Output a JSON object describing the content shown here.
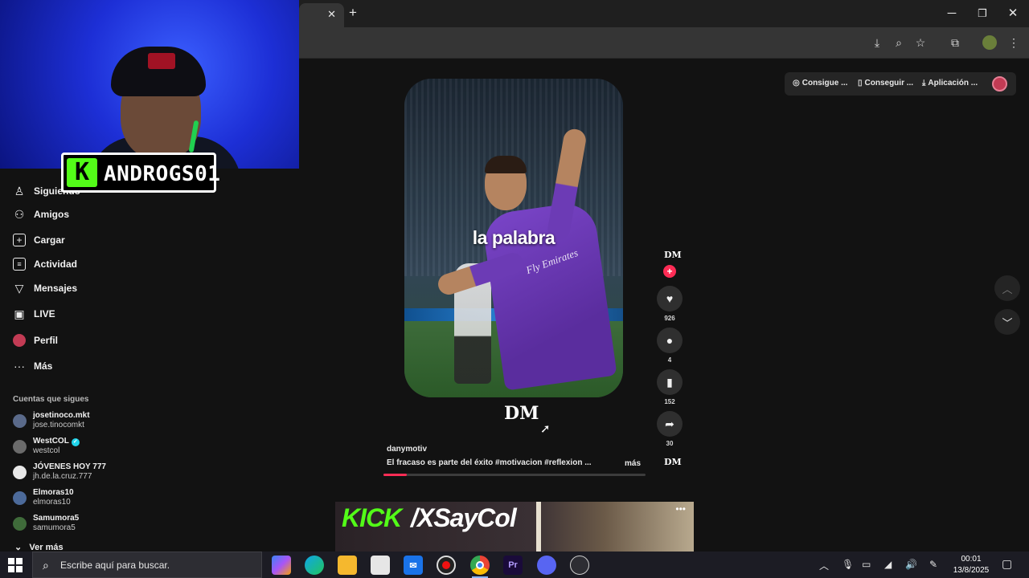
{
  "streamer": {
    "badge_letter": "K",
    "name": "ANDROGS01"
  },
  "browser": {
    "tab_close": "✕",
    "new_tab": "+",
    "window_controls": {
      "minimize": "─",
      "maximize": "❐",
      "close": "✕"
    },
    "toolbar_icons": [
      "install-app-icon",
      "zoom-icon",
      "bookmark-star-icon",
      "extensions-icon",
      "profile-avatar-icon",
      "menu-dots-icon"
    ]
  },
  "tiktok_actions": [
    {
      "icon": "coins-icon",
      "label": "Consigue ..."
    },
    {
      "icon": "phone-icon",
      "label": "Conseguir ..."
    },
    {
      "icon": "download-icon",
      "label": "Aplicación ..."
    }
  ],
  "sidebar": {
    "items": [
      {
        "icon": "following-icon",
        "label": "Siguiendo"
      },
      {
        "icon": "friends-icon",
        "label": "Amigos"
      },
      {
        "icon": "upload-icon",
        "label": "Cargar"
      },
      {
        "icon": "activity-icon",
        "label": "Actividad"
      },
      {
        "icon": "messages-icon",
        "label": "Mensajes"
      },
      {
        "icon": "live-icon",
        "label": "LIVE"
      },
      {
        "icon": "profile-icon",
        "label": "Perfil"
      },
      {
        "icon": "more-icon",
        "label": "Más"
      }
    ],
    "following_title": "Cuentas que sigues",
    "accounts": [
      {
        "name": "josetinoco.mkt",
        "handle": "jose.tinocomkt",
        "verified": false
      },
      {
        "name": "WestCOL",
        "handle": "westcol",
        "verified": true
      },
      {
        "name": "JÓVENES HOY 777",
        "handle": "jh.de.la.cruz.777",
        "verified": false
      },
      {
        "name": "Elmoras10",
        "handle": "elmoras10",
        "verified": false
      },
      {
        "name": "Samumora5",
        "handle": "samumora5",
        "verified": false
      }
    ],
    "see_more": "Ver más"
  },
  "video": {
    "caption": "la palabra",
    "sponsor_text": "Fly Emirates",
    "watermark": "DM",
    "progress_fraction": 0.09
  },
  "post": {
    "author": "danymotiv",
    "description": "El fracaso es parte del éxito  #motivacion  #reflexion  ...",
    "more": "más"
  },
  "actions": {
    "creator_badge": "DM",
    "follow": "+",
    "likes": "926",
    "comments": "4",
    "saves": "152",
    "shares": "30",
    "music_badge": "DM"
  },
  "kick_banner": {
    "green": "KICK",
    "white": "/XSayCol",
    "dots": "•••"
  },
  "taskbar": {
    "search_placeholder": "Escribe aquí para buscar.",
    "apps": [
      "copilot-icon",
      "edge-icon",
      "file-explorer-icon",
      "store-icon",
      "mail-icon",
      "obs-icon",
      "chrome-icon",
      "premiere-icon",
      "discord-like-icon",
      "app-icon"
    ],
    "premiere_label": "Pr",
    "time": "00:01",
    "date": "13/8/2025"
  },
  "colors": {
    "tiktok_red": "#fe2c55",
    "kick_green": "#53fc18",
    "verified": "#20d5ec"
  }
}
